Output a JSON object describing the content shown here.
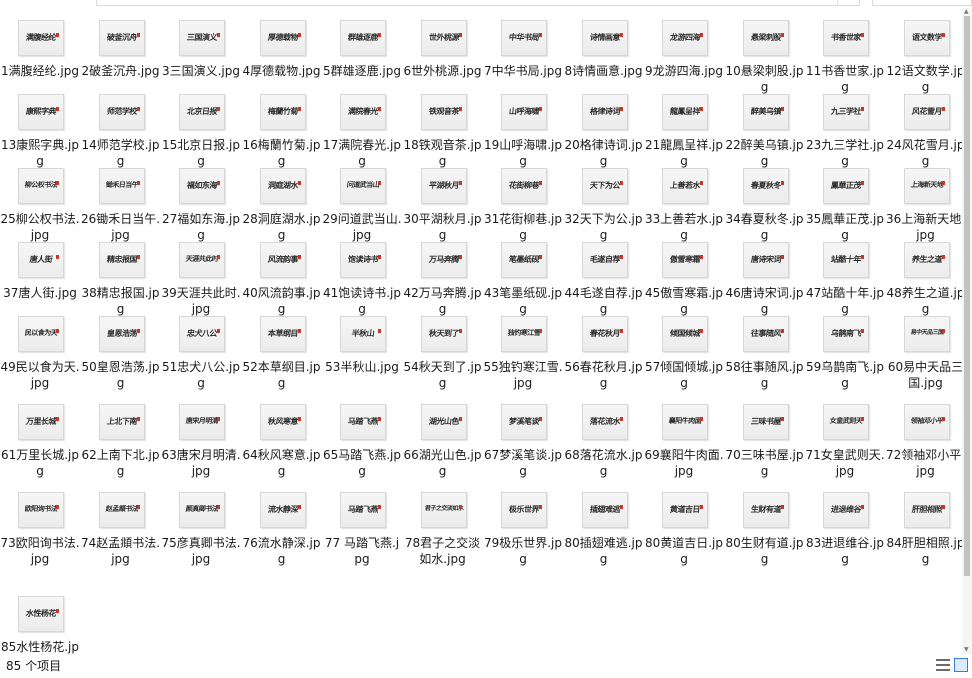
{
  "status": {
    "item_count": "85 个项目"
  },
  "icons": {
    "details_view": "details-view-icon",
    "large_icons_view": "large-icons-view-icon",
    "accent": "#3a7bd5"
  },
  "files": [
    {
      "name": "1满腹经纶.jpg",
      "thumb": "满腹经纶"
    },
    {
      "name": "2破釜沉舟.jpg",
      "thumb": "破釜沉舟"
    },
    {
      "name": "3三国演义.jpg",
      "thumb": "三国演义"
    },
    {
      "name": "4厚德载物.jpg",
      "thumb": "厚德载物"
    },
    {
      "name": "5群雄逐鹿.jpg",
      "thumb": "群雄逐鹿"
    },
    {
      "name": "6世外桃源.jpg",
      "thumb": "世外桃源"
    },
    {
      "name": "7中华书局.jpg",
      "thumb": "中华书局"
    },
    {
      "name": "8诗情画意.jpg",
      "thumb": "诗情画意"
    },
    {
      "name": "9龙游四海.jpg",
      "thumb": "龙游四海"
    },
    {
      "name": "10悬梁刺股.jpg",
      "thumb": "悬梁刺股"
    },
    {
      "name": "11书香世家.jpg",
      "thumb": "书香世家"
    },
    {
      "name": "12语文数学.jpg",
      "thumb": "语文数学"
    },
    {
      "name": "13康熙字典.jpg",
      "thumb": "康熙字典"
    },
    {
      "name": "14师范学校.jpg",
      "thumb": "师范学校"
    },
    {
      "name": "15北京日报.jpg",
      "thumb": "北京日报"
    },
    {
      "name": "16梅蘭竹菊.jpg",
      "thumb": "梅蘭竹菊"
    },
    {
      "name": "17满院春光.jpg",
      "thumb": "满院春光"
    },
    {
      "name": "18铁观音茶.jpg",
      "thumb": "铁观音茶"
    },
    {
      "name": "19山呼海啸.jpg",
      "thumb": "山呼海啸"
    },
    {
      "name": "20格律诗词.jpg",
      "thumb": "格律诗词"
    },
    {
      "name": "21龍鳳呈祥.jpg",
      "thumb": "龍鳳呈祥"
    },
    {
      "name": "22醉美乌镇.jpg",
      "thumb": "醉美乌镇"
    },
    {
      "name": "23九三学社.jpg",
      "thumb": "九三学社"
    },
    {
      "name": "24风花雪月.jpg",
      "thumb": "风花雪月"
    },
    {
      "name": "25柳公权书法.jpg",
      "thumb": "柳公权书法"
    },
    {
      "name": "26锄禾日当午.jpg",
      "thumb": "锄禾日当午"
    },
    {
      "name": "27福如东海.jpg",
      "thumb": "福如东海"
    },
    {
      "name": "28洞庭湖水.jpg",
      "thumb": "洞庭湖水"
    },
    {
      "name": "29问道武当山.jpg",
      "thumb": "问道武当山"
    },
    {
      "name": "30平湖秋月.jpg",
      "thumb": "平湖秋月"
    },
    {
      "name": "31花街柳巷.jpg",
      "thumb": "花街柳巷"
    },
    {
      "name": "32天下为公.jpg",
      "thumb": "天下为公"
    },
    {
      "name": "33上善若水.jpg",
      "thumb": "上善若水"
    },
    {
      "name": "34春夏秋冬.jpg",
      "thumb": "春夏秋冬"
    },
    {
      "name": "35鳳華正茂.jpg",
      "thumb": "鳳華正茂"
    },
    {
      "name": "36上海新天地.jpg",
      "thumb": "上海新天地"
    },
    {
      "name": "37唐人街.jpg",
      "thumb": "唐人街"
    },
    {
      "name": "38精忠报国.jpg",
      "thumb": "精忠报国"
    },
    {
      "name": "39天涯共此时.jpg",
      "thumb": "天涯共此时"
    },
    {
      "name": "40风流韵事.jpg",
      "thumb": "风流韵事"
    },
    {
      "name": "41饱读诗书.jpg",
      "thumb": "饱读诗书"
    },
    {
      "name": "42万马奔腾.jpg",
      "thumb": "万马奔腾"
    },
    {
      "name": "43笔墨纸砚.jpg",
      "thumb": "笔墨纸砚"
    },
    {
      "name": "44毛遂自荐.jpg",
      "thumb": "毛遂自荐"
    },
    {
      "name": "45傲雪寒霜.jpg",
      "thumb": "傲雪寒霜"
    },
    {
      "name": "46唐诗宋词.jpg",
      "thumb": "唐诗宋词"
    },
    {
      "name": "47站酷十年.jpg",
      "thumb": "站酷十年"
    },
    {
      "name": "48养生之道.jpg",
      "thumb": "养生之道"
    },
    {
      "name": "49民以食为天.jpg",
      "thumb": "民以食为天"
    },
    {
      "name": "50皇恩浩荡.jpg",
      "thumb": "皇恩浩荡"
    },
    {
      "name": "51忠犬八公.jpg",
      "thumb": "忠犬八公"
    },
    {
      "name": "52本草纲目.jpg",
      "thumb": "本草纲目"
    },
    {
      "name": "53半秋山.jpg",
      "thumb": "半秋山"
    },
    {
      "name": "54秋天到了.jpg",
      "thumb": "秋天到了"
    },
    {
      "name": "55独钓寒江雪.jpg",
      "thumb": "独钓寒江雪"
    },
    {
      "name": "56春花秋月.jpg",
      "thumb": "春花秋月"
    },
    {
      "name": "57倾国倾城.jpg",
      "thumb": "倾国倾城"
    },
    {
      "name": "58往事随风.jpg",
      "thumb": "往事随风"
    },
    {
      "name": "59乌鹊南飞.jpg",
      "thumb": "乌鹊南飞"
    },
    {
      "name": "60易中天品三国.jpg",
      "thumb": "易中天品三国"
    },
    {
      "name": "61万里长城.jpg",
      "thumb": "万里长城"
    },
    {
      "name": "62上南下北.jpg",
      "thumb": "上北下南"
    },
    {
      "name": "63唐宋月明清.jpg",
      "thumb": "唐宋月明清"
    },
    {
      "name": "64秋风寒意.jpg",
      "thumb": "秋风寒意"
    },
    {
      "name": "65马踏飞燕.jpg",
      "thumb": "马踏飞燕"
    },
    {
      "name": "66湖光山色.jpg",
      "thumb": "湖光山色"
    },
    {
      "name": "67梦溪笔谈.jpg",
      "thumb": "梦溪笔谈"
    },
    {
      "name": "68落花流水.jpg",
      "thumb": "落花流水"
    },
    {
      "name": "69襄阳牛肉面.jpg",
      "thumb": "襄阳牛肉面"
    },
    {
      "name": "70三味书屋.jpg",
      "thumb": "三味书屋"
    },
    {
      "name": "71女皇武则天.jpg",
      "thumb": "女皇武则天"
    },
    {
      "name": "72领袖邓小平.jpg",
      "thumb": "领袖邓小平"
    },
    {
      "name": "73欧阳询书法.jpg",
      "thumb": "欧阳询书法"
    },
    {
      "name": "74赵孟頫书法.jpg",
      "thumb": "赵孟頫书法"
    },
    {
      "name": "75彦真卿书法.jpg",
      "thumb": "颜真卿书法"
    },
    {
      "name": "76流水静深.jpg",
      "thumb": "流水静深"
    },
    {
      "name": "77 马踏飞燕.jpg",
      "thumb": "马踏飞燕"
    },
    {
      "name": "78君子之交淡如水.jpg",
      "thumb": "君子之交淡如水"
    },
    {
      "name": "79极乐世界.jpg",
      "thumb": "极乐世界"
    },
    {
      "name": "80插翅难逃.jpg",
      "thumb": "插翅难逃"
    },
    {
      "name": "80黄道吉日.jpg",
      "thumb": "黄道吉日"
    },
    {
      "name": "80生财有道.jpg",
      "thumb": "生财有道"
    },
    {
      "name": "83进退维谷.jpg",
      "thumb": "进退维谷"
    },
    {
      "name": "84肝胆相照.jpg",
      "thumb": "肝胆相照"
    },
    {
      "name": "85水性杨花.jpg",
      "thumb": "水性杨花"
    }
  ]
}
